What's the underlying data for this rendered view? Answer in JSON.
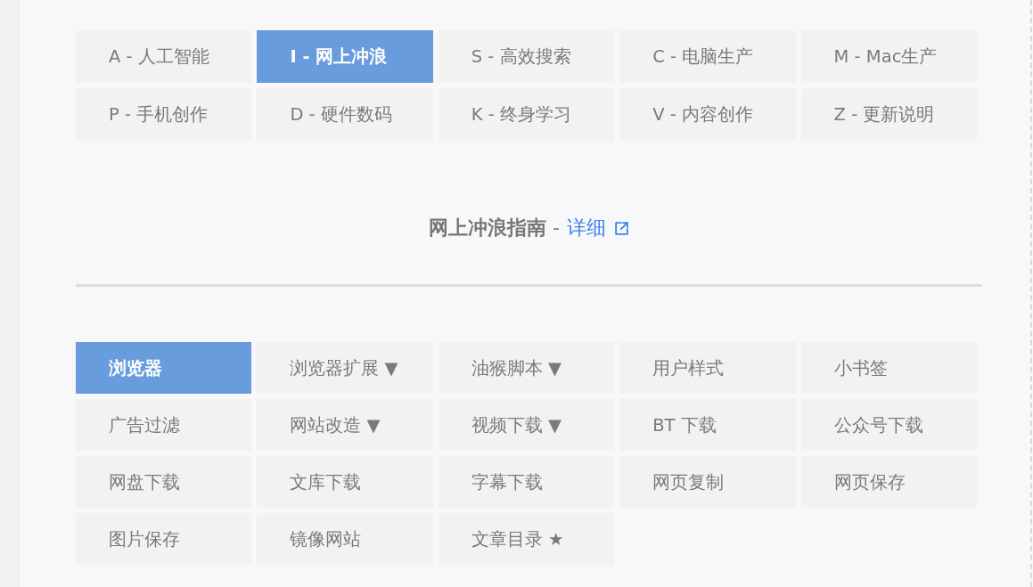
{
  "categories": [
    {
      "label": "A - 人工智能",
      "selected": false
    },
    {
      "label": "I - 网上冲浪",
      "selected": true
    },
    {
      "label": "S - 高效搜索",
      "selected": false
    },
    {
      "label": "C - 电脑生产",
      "selected": false
    },
    {
      "label": "M - Mac生产",
      "selected": false
    },
    {
      "label": "P - 手机创作",
      "selected": false
    },
    {
      "label": "D - 硬件数码",
      "selected": false
    },
    {
      "label": "K - 终身学习",
      "selected": false
    },
    {
      "label": "V - 内容创作",
      "selected": false
    },
    {
      "label": "Z - 更新说明",
      "selected": false
    }
  ],
  "section": {
    "title": "**网上冲浪指南** -",
    "link": "详细"
  },
  "subcategories": [
    {
      "label": "浏览器",
      "selected": true
    },
    {
      "label": "浏览器扩展 ▼",
      "selected": false
    },
    {
      "label": "油猴脚本 ▼",
      "selected": false
    },
    {
      "label": "用户样式",
      "selected": false
    },
    {
      "label": "小书签",
      "selected": false
    },
    {
      "label": "广告过滤",
      "selected": false
    },
    {
      "label": "网站改造 ▼",
      "selected": false
    },
    {
      "label": "视频下载 ▼",
      "selected": false
    },
    {
      "label": "BT 下载",
      "selected": false
    },
    {
      "label": "公众号下载",
      "selected": false
    },
    {
      "label": "网盘下载",
      "selected": false
    },
    {
      "label": "文库下载",
      "selected": false
    },
    {
      "label": "字幕下载",
      "selected": false
    },
    {
      "label": "网页复制",
      "selected": false
    },
    {
      "label": "网页保存",
      "selected": false
    },
    {
      "label": "图片保存",
      "selected": false
    },
    {
      "label": "镜像网站",
      "selected": false
    },
    {
      "label": "文章目录 ★",
      "selected": false
    }
  ]
}
